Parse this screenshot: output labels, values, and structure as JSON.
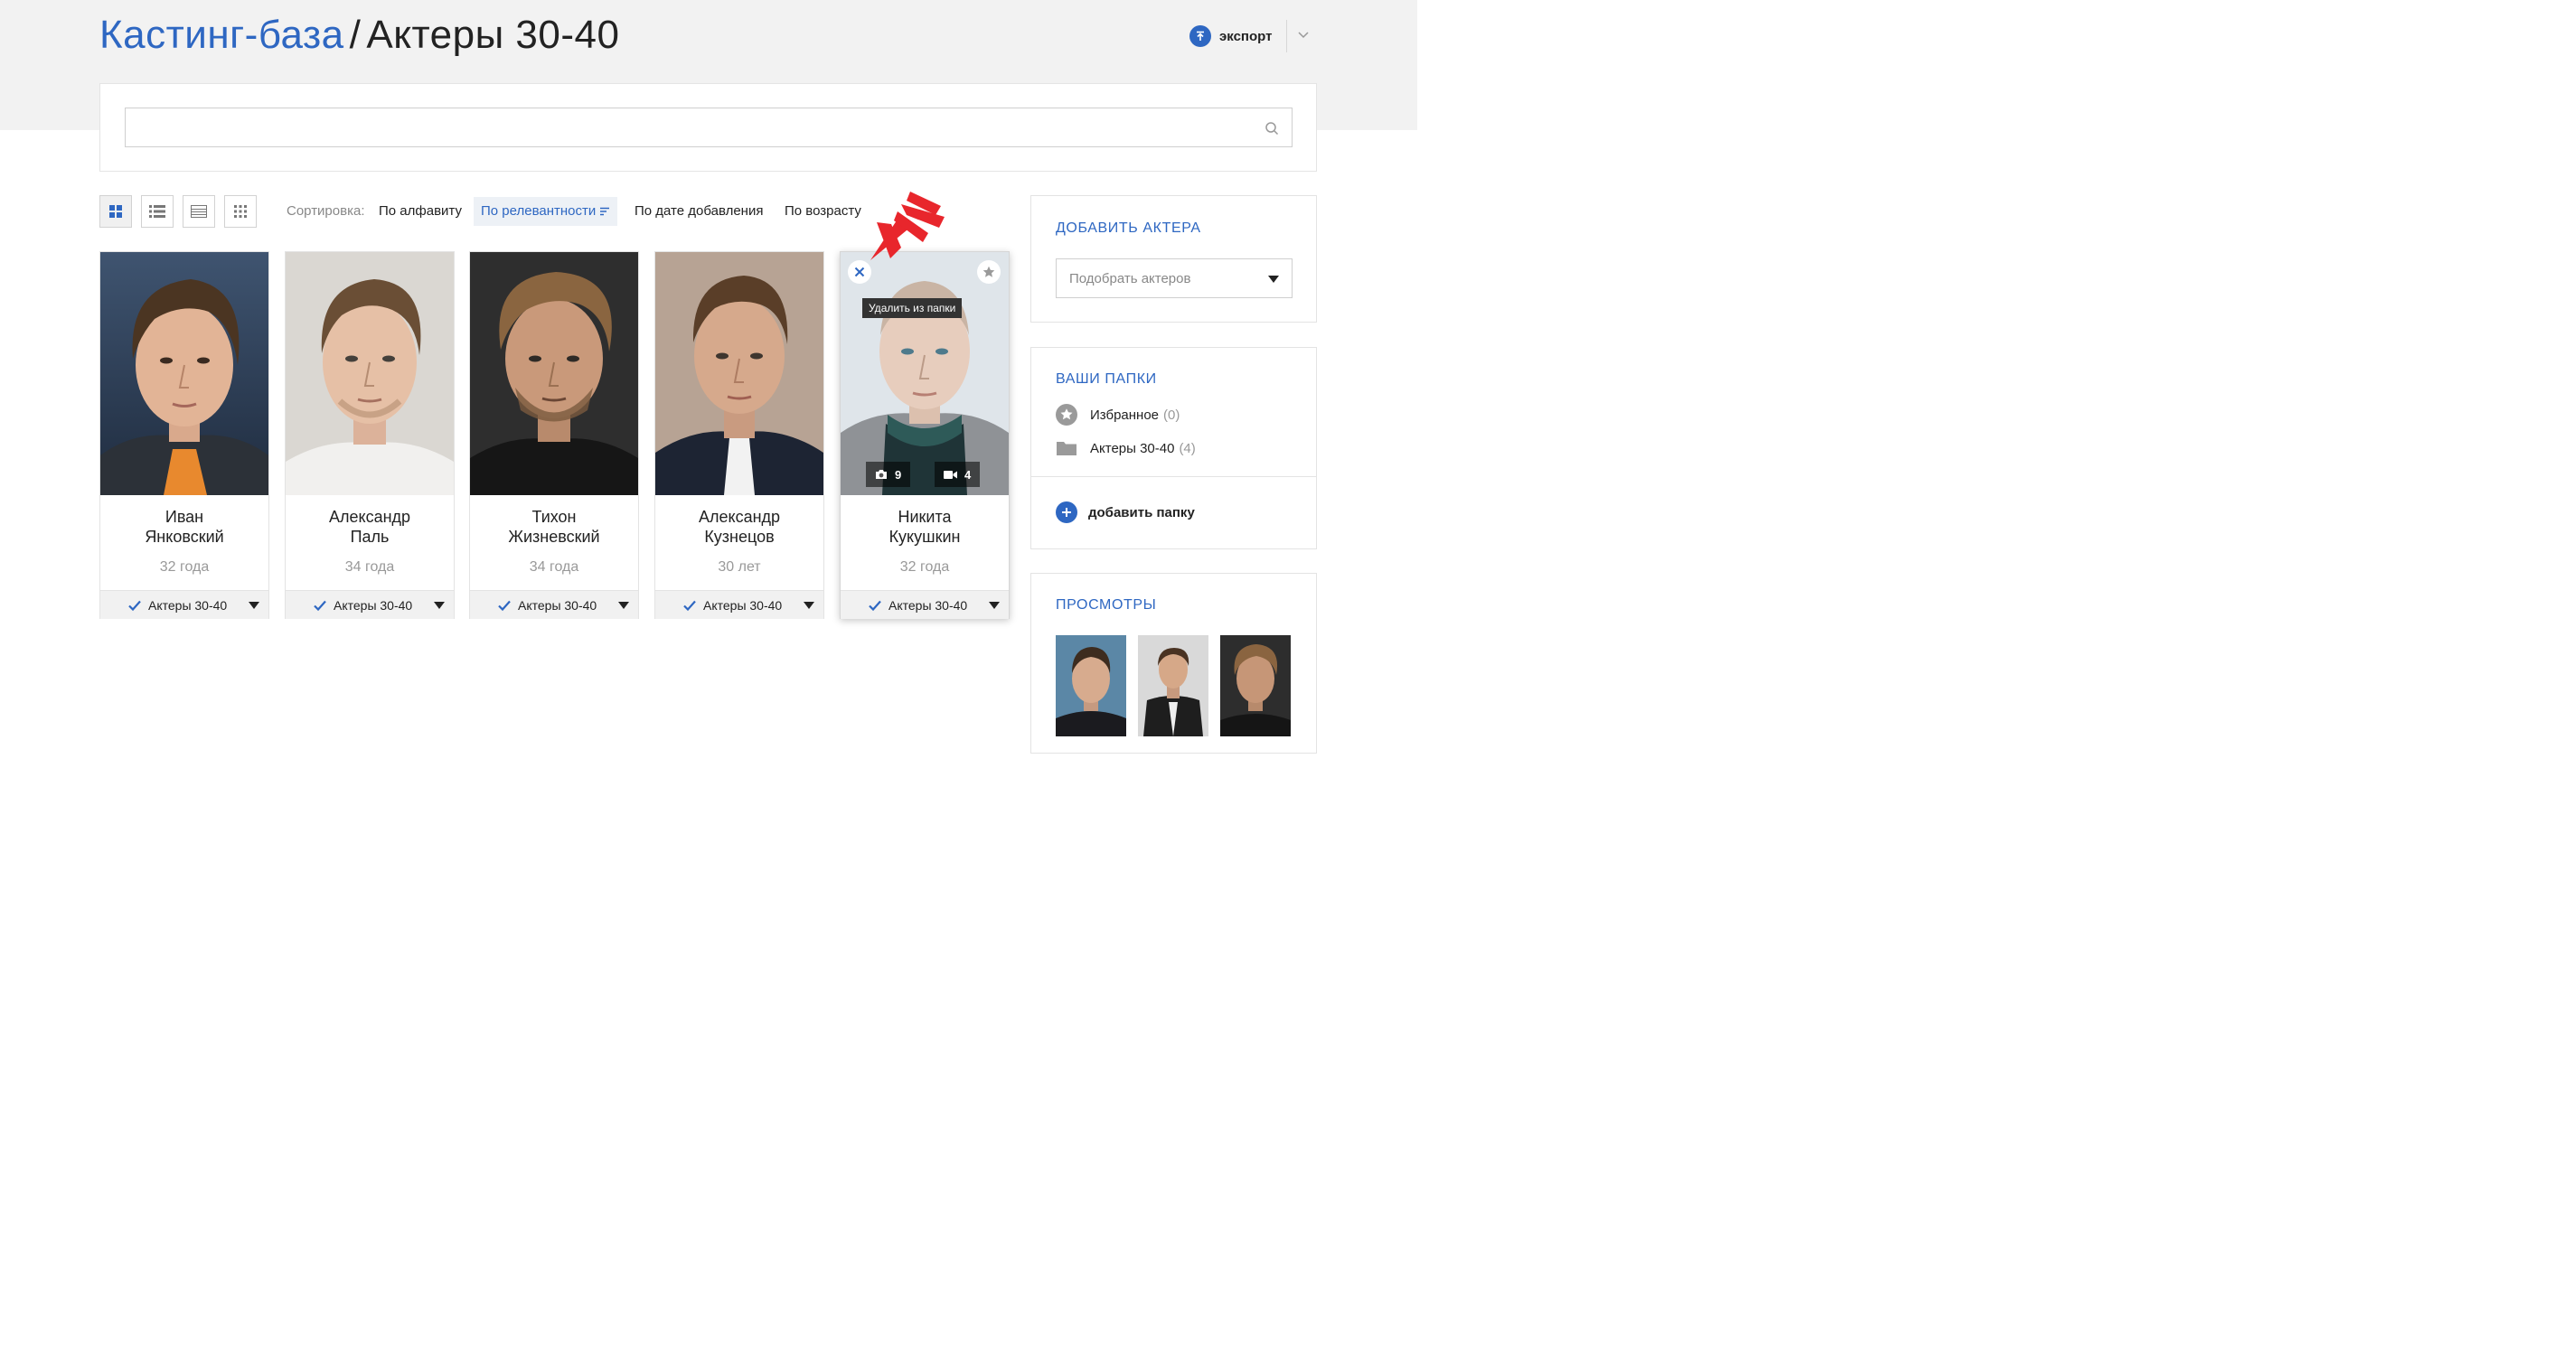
{
  "header": {
    "breadcrumb_root": "Кастинг-база",
    "separator": "/",
    "current": "Актеры 30-40",
    "export_label": "экспорт"
  },
  "search": {
    "value": "",
    "placeholder": ""
  },
  "toolbar": {
    "sort_label": "Сортировка:",
    "sort_options": [
      {
        "label": "По алфавиту",
        "active": false
      },
      {
        "label": "По релевантности",
        "active": true
      },
      {
        "label": "По дате добавления",
        "active": false
      },
      {
        "label": "По возрасту",
        "active": false
      }
    ],
    "view_modes": [
      "grid-large-icon",
      "list-icon",
      "table-icon",
      "grid-small-icon"
    ]
  },
  "actors": [
    {
      "first_name": "Иван",
      "last_name": "Янковский",
      "age": "32 года",
      "folder": "Актеры 30-40"
    },
    {
      "first_name": "Александр",
      "last_name": "Паль",
      "age": "34 года",
      "folder": "Актеры 30-40"
    },
    {
      "first_name": "Тихон",
      "last_name": "Жизневский",
      "age": "34 года",
      "folder": "Актеры 30-40"
    },
    {
      "first_name": "Александр",
      "last_name": "Кузнецов",
      "age": "30 лет",
      "folder": "Актеры 30-40"
    },
    {
      "first_name": "Никита",
      "last_name": "Кукушкин",
      "age": "32 года",
      "folder": "Актеры 30-40",
      "photos_count": "9",
      "videos_count": "4",
      "tooltip": "Удалить из папки"
    }
  ],
  "sidebar": {
    "add_actor": {
      "title": "ДОБАВИТЬ АКТЕРА",
      "select_value": "Подобрать актеров"
    },
    "folders": {
      "title": "ВАШИ ПАПКИ",
      "items": [
        {
          "label": "Избранное",
          "count": "(0)",
          "icon": "star-icon"
        },
        {
          "label": "Актеры 30-40",
          "count": "(4)",
          "icon": "folder-icon"
        }
      ],
      "add_label": "добавить папку"
    },
    "views": {
      "title": "ПРОСМОТРЫ"
    }
  },
  "colors": {
    "accent": "#2e67c2",
    "arrow": "#e8262c",
    "header_bg": "#f2f2f2"
  }
}
